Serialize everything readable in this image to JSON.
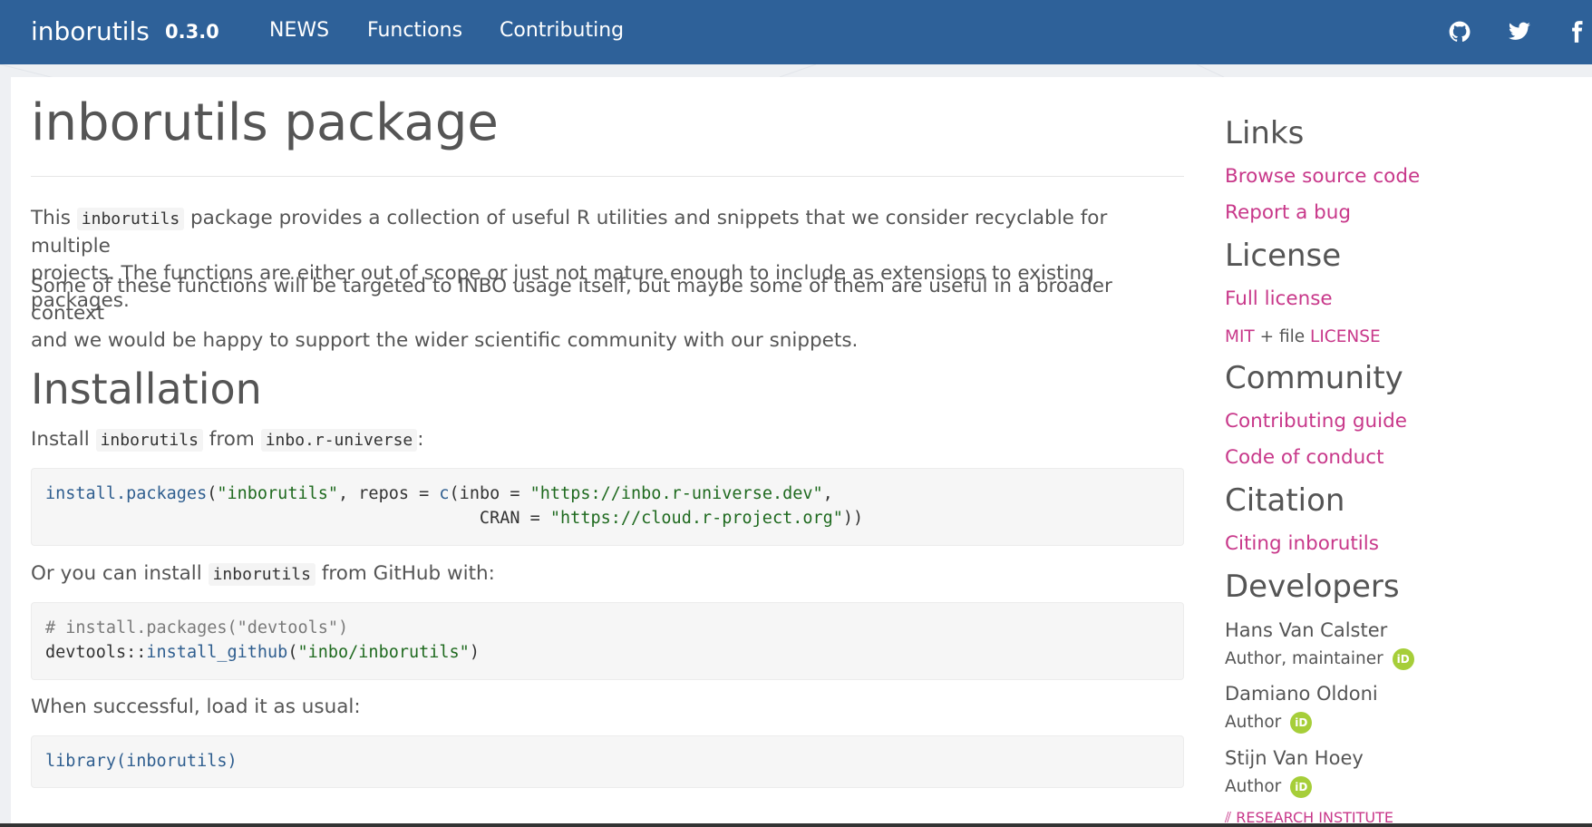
{
  "navbar": {
    "brand": "inborutils",
    "version": "0.3.0",
    "links": [
      "NEWS",
      "Functions",
      "Contributing"
    ],
    "icons": [
      "github-icon",
      "twitter-icon",
      "facebook-icon"
    ],
    "bg_color": "#2e6199"
  },
  "main": {
    "title": "inborutils package",
    "intro": {
      "p1_pre": "This",
      "p1_code": "inborutils",
      "p1_post_line1": "package provides a collection of useful R utilities and snippets that we consider recyclable for multiple",
      "p1_line2": "projects. The functions are either out of scope or just not mature enough to include as extensions to existing packages.",
      "p2_line1": "Some of these functions will be targeted to INBO usage itself, but maybe some of them are useful in a broader context",
      "p2_line2": "and we would be happy to support the wider scientific community with our snippets."
    },
    "installation": {
      "heading": "Installation",
      "install_pre": "Install",
      "install_code1": "inborutils",
      "install_mid": "from",
      "install_code2": "inbo.r-universe",
      "install_post": ":",
      "code1_line1_fn": "install.packages",
      "code1_line1_a": "(",
      "code1_line1_s1": "\"inborutils\"",
      "code1_line1_b": ", repos = ",
      "code1_line1_fn2": "c",
      "code1_line1_c": "(inbo = ",
      "code1_line1_s2": "\"https://inbo.r-universe.dev\"",
      "code1_line1_d": ",",
      "code1_line2_a": "                                           CRAN = ",
      "code1_line2_s": "\"https://cloud.r-project.org\"",
      "code1_line2_b": "))",
      "github_pre": "Or you can install",
      "github_code": "inborutils",
      "github_post": "from GitHub with:",
      "code2_line1": "# install.packages(\"devtools\")",
      "code2_line2_a": "devtools::",
      "code2_line2_fn": "install_github",
      "code2_line2_b": "(",
      "code2_line2_s": "\"inbo/inborutils\"",
      "code2_line2_c": ")",
      "load_text": "When successful, load it as usual:",
      "code3_fn": "library",
      "code3_rest": "(inborutils)"
    }
  },
  "sidebar": {
    "links_heading": "Links",
    "browse_source": "Browse source code",
    "report_bug": "Report a bug",
    "license_heading": "License",
    "full_license": "Full license",
    "license_mit": "MIT",
    "license_plus": " + file ",
    "license_file": "LICENSE",
    "community_heading": "Community",
    "contributing_guide": "Contributing guide",
    "code_of_conduct": "Code of conduct",
    "citation_heading": "Citation",
    "citing": "Citing inborutils",
    "developers_heading": "Developers",
    "developers": [
      {
        "name": "Hans Van Calster",
        "role": "Author, maintainer"
      },
      {
        "name": "Damiano Oldoni",
        "role": "Author"
      },
      {
        "name": "Stijn Van Hoey",
        "role": "Author"
      }
    ],
    "orcid_label": "iD",
    "logo_text": "RESEARCH INSTITUTE"
  },
  "colors": {
    "accent_link": "#c8388a",
    "orcid": "#a6ce39"
  }
}
